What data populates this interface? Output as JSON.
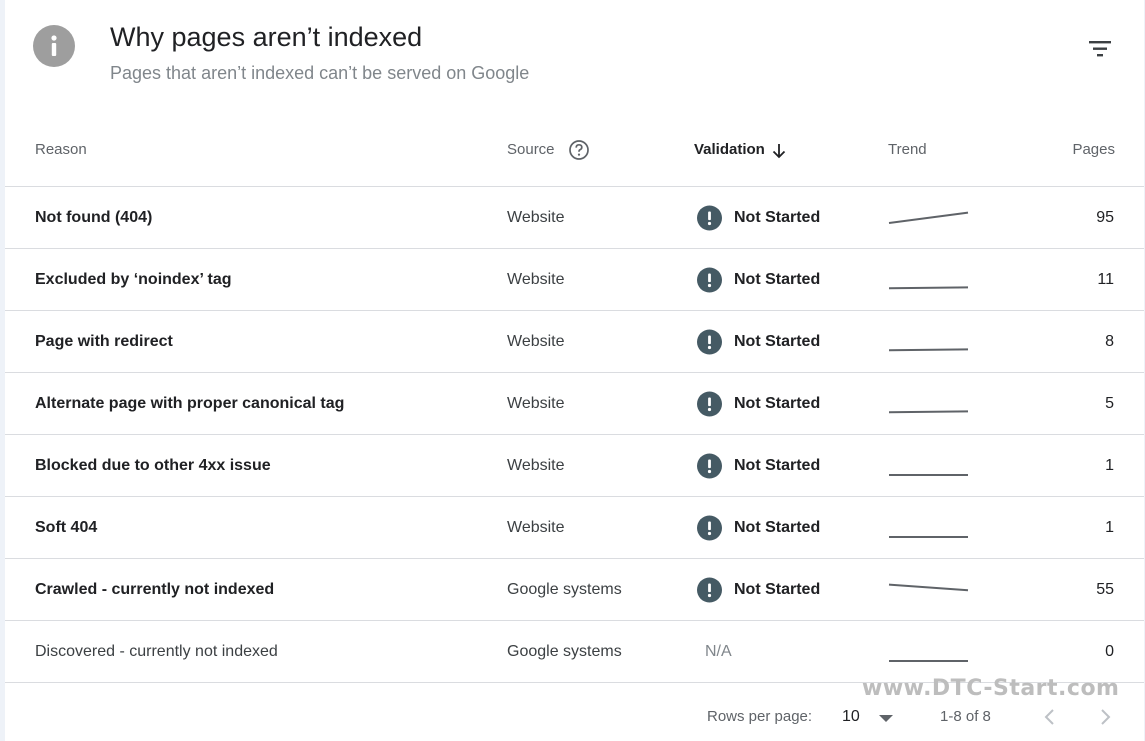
{
  "header": {
    "title": "Why pages aren’t indexed",
    "subtitle": "Pages that aren’t indexed can’t be served on Google",
    "info_icon": "info-icon",
    "filter_icon": "filter-icon"
  },
  "columns": {
    "reason": "Reason",
    "source": "Source",
    "validation": "Validation",
    "trend": "Trend",
    "pages": "Pages"
  },
  "rows": [
    {
      "reason": "Not found (404)",
      "source": "Website",
      "validation": "Not Started",
      "pages": "95",
      "trend": [
        0.25,
        0.9
      ]
    },
    {
      "reason": "Excluded by ‘noindex’ tag",
      "source": "Website",
      "validation": "Not Started",
      "pages": "11",
      "trend": [
        0.05,
        0.1
      ]
    },
    {
      "reason": "Page with redirect",
      "source": "Website",
      "validation": "Not Started",
      "pages": "8",
      "trend": [
        0.05,
        0.1
      ]
    },
    {
      "reason": "Alternate page with proper canonical tag",
      "source": "Website",
      "validation": "Not Started",
      "pages": "5",
      "trend": [
        0.05,
        0.1
      ]
    },
    {
      "reason": "Blocked due to other 4xx issue",
      "source": "Website",
      "validation": "Not Started",
      "pages": "1",
      "trend": [
        0.0,
        0.0
      ]
    },
    {
      "reason": "Soft 404",
      "source": "Website",
      "validation": "Not Started",
      "pages": "1",
      "trend": [
        0.0,
        0.0
      ]
    },
    {
      "reason": "Crawled - currently not indexed",
      "source": "Google systems",
      "validation": "Not Started",
      "pages": "55",
      "trend": [
        0.9,
        0.55
      ]
    },
    {
      "reason": "Discovered - currently not indexed",
      "source": "Google systems",
      "validation": "N/A",
      "pages": "0",
      "trend": [
        0.0,
        0.0
      ]
    }
  ],
  "footer": {
    "rows_per_page_label": "Rows per page:",
    "rows_per_page_value": "10",
    "range": "1-8 of 8"
  },
  "watermark": "www.DTC-Start.com",
  "colors": {
    "status_icon": "#455a64",
    "trend_line": "#5f6368",
    "divider": "#dadce0"
  }
}
